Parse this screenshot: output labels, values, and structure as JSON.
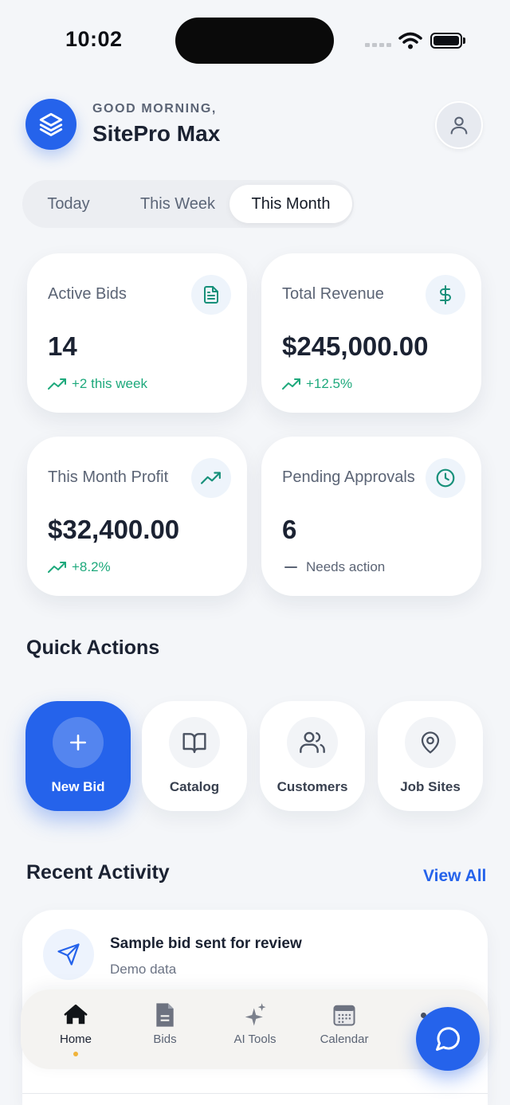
{
  "status_bar": {
    "time": "10:02"
  },
  "header": {
    "greeting": "GOOD MORNING,",
    "app_name": "SitePro Max"
  },
  "period_tabs": [
    {
      "label": "Today",
      "selected": false
    },
    {
      "label": "This Week",
      "selected": false
    },
    {
      "label": "This Month",
      "selected": true
    }
  ],
  "stats": [
    {
      "label": "Active Bids",
      "value": "14",
      "trend": "+2 this week",
      "icon": "document-icon",
      "trend_type": "up"
    },
    {
      "label": "Total Revenue",
      "value": "$245,000.00",
      "trend": "+12.5%",
      "icon": "dollar-icon",
      "trend_type": "up"
    },
    {
      "label": "This Month Profit",
      "value": "$32,400.00",
      "trend": "+8.2%",
      "icon": "trending-up-icon",
      "trend_type": "up"
    },
    {
      "label": "Pending Approvals",
      "value": "6",
      "trend": "Needs action",
      "icon": "clock-icon",
      "trend_type": "neutral"
    }
  ],
  "quick_actions": {
    "title": "Quick Actions",
    "items": [
      {
        "label": "New Bid",
        "icon": "plus-icon",
        "primary": true
      },
      {
        "label": "Catalog",
        "icon": "book-icon"
      },
      {
        "label": "Customers",
        "icon": "users-icon"
      },
      {
        "label": "Job Sites",
        "icon": "map-pin-icon"
      }
    ]
  },
  "recent_activity": {
    "title": "Recent Activity",
    "view_all": "View All",
    "items": [
      {
        "title": "Sample bid sent for review",
        "subtitle": "Demo data",
        "icon": "send-icon"
      }
    ]
  },
  "bottom_nav": [
    {
      "label": "Home",
      "icon": "home-icon",
      "active": true
    },
    {
      "label": "Bids",
      "icon": "file-icon"
    },
    {
      "label": "AI Tools",
      "icon": "sparkle-icon"
    },
    {
      "label": "Calendar",
      "icon": "calendar-icon"
    }
  ],
  "colors": {
    "accent": "#2563eb",
    "positive": "#1ea97c",
    "teal_icon": "#17907a",
    "background": "#f4f6f9"
  }
}
